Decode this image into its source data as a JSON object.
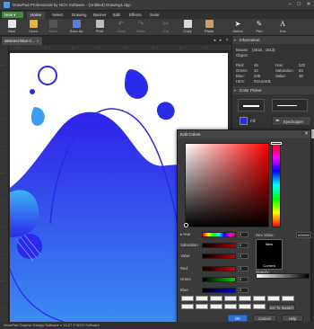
{
  "window": {
    "title": "DrawPad Professional by NCH Software - (Untitled) Drawing1.dpp"
  },
  "menu": {
    "new_label": "New",
    "items": [
      "Home",
      "Select",
      "Drawing",
      "Banner",
      "Edit",
      "Effects",
      "Suite"
    ],
    "active": "Home"
  },
  "toolbar": {
    "buttons": [
      {
        "label": "New",
        "icon": "new-icon"
      },
      {
        "label": "Open",
        "icon": "open-folder-icon"
      },
      {
        "label": "Save",
        "icon": "save-icon"
      },
      {
        "label": "Save As",
        "icon": "save-as-icon"
      },
      {
        "label": "Print",
        "icon": "print-icon"
      },
      {
        "label": "Undo",
        "icon": "undo-icon"
      },
      {
        "label": "Redo",
        "icon": "redo-icon"
      },
      {
        "label": "Cut",
        "icon": "scissors-icon"
      },
      {
        "label": "Copy",
        "icon": "copy-icon"
      },
      {
        "label": "Paste",
        "icon": "paste-icon"
      },
      {
        "label": "Select",
        "icon": "arrow-select-icon"
      },
      {
        "label": "Pen",
        "icon": "pen-icon"
      },
      {
        "label": "Text",
        "icon": "text-icon"
      }
    ]
  },
  "document_tab": {
    "label": "abstract-blue-C..."
  },
  "info_panel": {
    "title": "Information",
    "mouse_label": "Mouse:",
    "mouse_value": "(4616 , 1613)",
    "object_label": "Object:",
    "red_label": "Red:",
    "red_value": "46",
    "green_label": "Green:",
    "green_value": "42",
    "blue_label": "Blue:",
    "blue_value": "236",
    "hue_label": "Hue:",
    "hue_value": "242",
    "saturation_label": "Saturation:",
    "saturation_value": "83",
    "value_label": "Value:",
    "value_value": "38",
    "hex_label": "HEX:",
    "hex_value": "#2A2AEB"
  },
  "color_picker_panel": {
    "title": "Color Picker",
    "fill_label": "Fill",
    "eyedropper_label": "Eyedropper"
  },
  "edit_colors": {
    "title": "Edit Colors",
    "hue_label": "Hue",
    "saturation_label": "Saturation",
    "value_label": "Value",
    "red_label": "Red",
    "green_label": "Green",
    "blue_label": "Blue",
    "hex_label": "Hex Value:",
    "hex_value": "000000",
    "new_label": "New",
    "current_label": "Current",
    "opacity_label": "Opacity:",
    "set_swatch_label": "Set To Swatch",
    "ok_label": "OK",
    "cancel_label": "Cancel",
    "help_label": "Help"
  },
  "status": {
    "text": "DrawPad Graphic Design Software v 10.27 © NCH Software"
  },
  "colors": {
    "accent": "#2f6fd6",
    "art_blue": "#2a2aeb",
    "art_light_blue": "#3a9ef0",
    "new_green": "#3d8b3d"
  }
}
